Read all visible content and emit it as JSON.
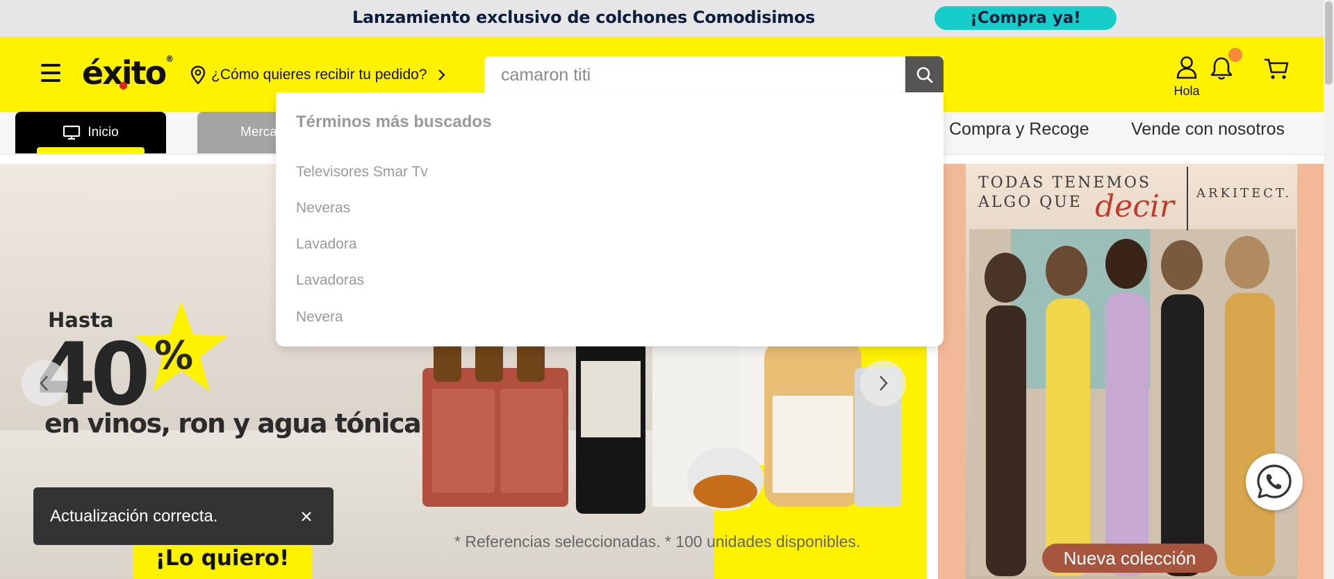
{
  "promo": {
    "text": "Lanzamiento exclusivo de colchones Comodisimos",
    "cta": "¡Compra ya!"
  },
  "header": {
    "logo": "éxito",
    "logo_mark": "®",
    "delivery_prompt": "¿Cómo quieres recibir tu pedido?",
    "search_value": "camaron titi",
    "account_label": "Hola"
  },
  "nav": {
    "tabs": [
      {
        "label": "Inicio",
        "icon": "monitor-icon",
        "active": true
      },
      {
        "label": "Mercado",
        "icon": "bottle-icon",
        "active": false
      }
    ],
    "links": [
      "Compra y Recoge",
      "Vende con nosotros"
    ]
  },
  "search_dropdown": {
    "title": "Términos más buscados",
    "items": [
      "Televisores Smar Tv",
      "Neveras",
      "Lavadora",
      "Lavadoras",
      "Nevera"
    ]
  },
  "hero": {
    "hasta": "Hasta",
    "percent": "40",
    "percent_sign": "%",
    "subtitle": "en vinos, ron y agua tónica.",
    "disclaimer": "* Referencias seleccionadas. * 100 unidades disponibles.",
    "cta": "¡Lo quiero!"
  },
  "side_banner": {
    "line1": "TODAS TENEMOS",
    "line2": "ALGO QUE",
    "accent": "decir",
    "brand": "ARKITECT.",
    "cta": "Nueva colección"
  },
  "toast": {
    "message": "Actualización correcta."
  },
  "colors": {
    "brand_yellow": "#fff200",
    "promo_teal": "#17cdc9",
    "badge_orange": "#f7893a"
  }
}
